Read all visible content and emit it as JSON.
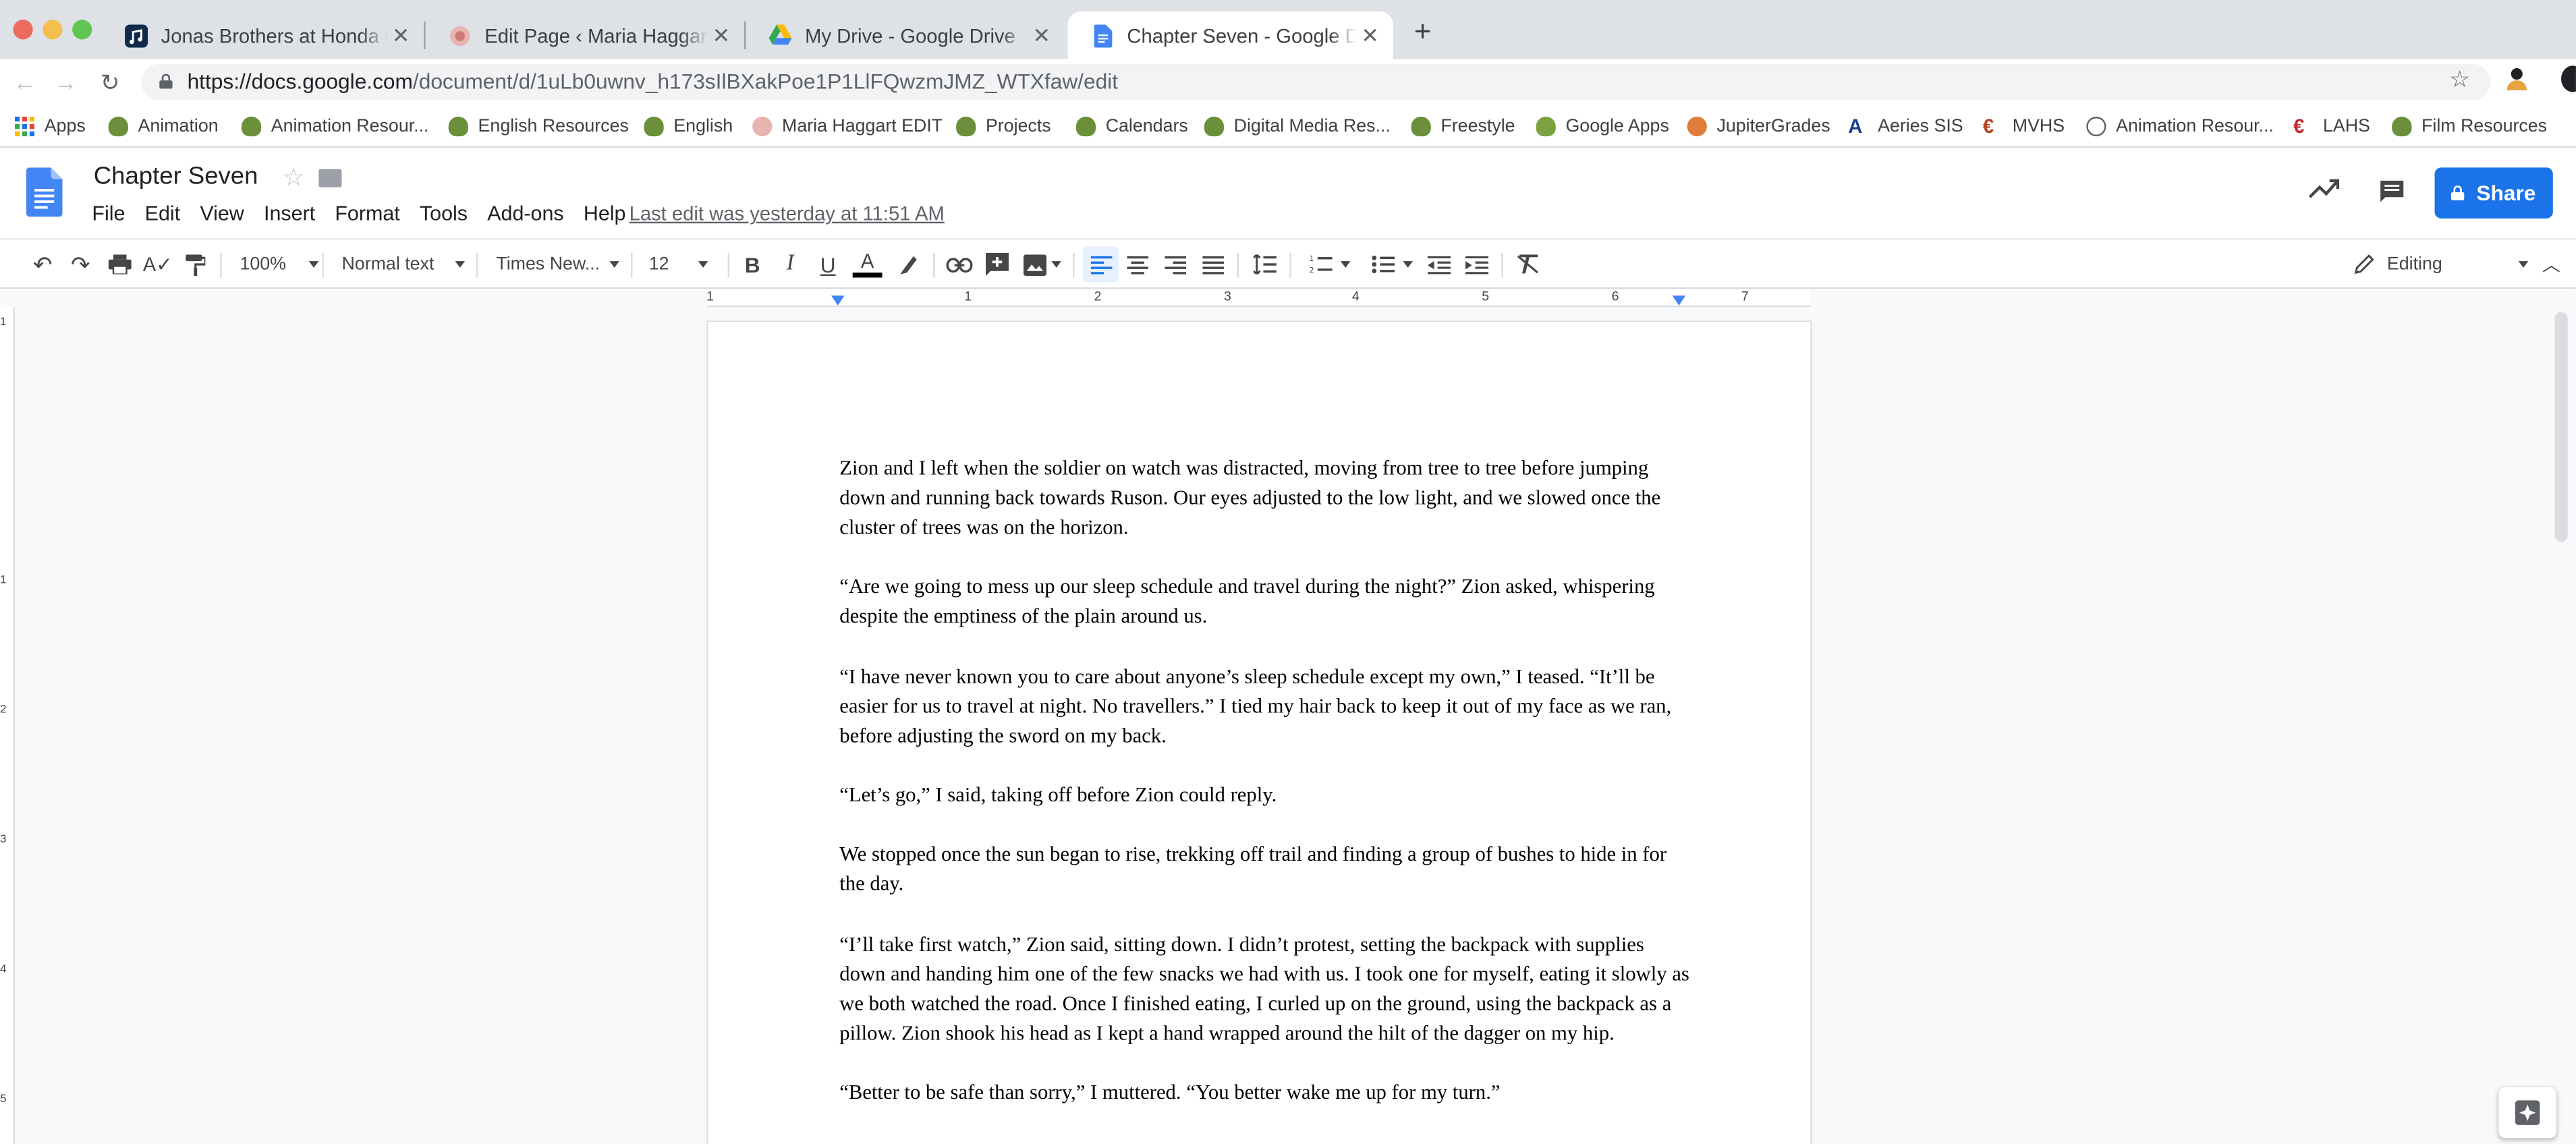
{
  "browser": {
    "tabs": [
      {
        "title": "Jonas Brothers at Honda Center",
        "icon": "music-note-icon"
      },
      {
        "title": "Edit Page ‹ Maria Haggart — WordPress",
        "icon": "site-icon"
      },
      {
        "title": "My Drive - Google Drive",
        "icon": "google-drive-icon"
      },
      {
        "title": "Chapter Seven - Google Docs",
        "icon": "google-docs-icon"
      }
    ],
    "url_host": "https://docs.google.com",
    "url_path": "/document/d/1uLb0uwnv_h173sIlBXakPoe1P1LlFQwzmJMZ_WTXfaw/edit"
  },
  "bookmarks": [
    "Apps",
    "Animation",
    "Animation Resour...",
    "English Resources",
    "English",
    "Maria Haggart EDIT",
    "Projects",
    "Calendars",
    "Digital Media Res...",
    "Freestyle",
    "Google Apps",
    "JupiterGrades",
    "Aeries SIS",
    "MVHS",
    "Animation Resour...",
    "LAHS",
    "Film Resources"
  ],
  "docs": {
    "title": "Chapter Seven",
    "menu": [
      "File",
      "Edit",
      "View",
      "Insert",
      "Format",
      "Tools",
      "Add-ons",
      "Help"
    ],
    "last_edit": "Last edit was yesterday at 11:51 AM",
    "share_label": "Share"
  },
  "toolbar": {
    "zoom": "100%",
    "style": "Normal text",
    "font": "Times New...",
    "font_size": "12",
    "mode": "Editing",
    "text_color": "#000000"
  },
  "ruler": {
    "h_labels": [
      "1",
      "1",
      "2",
      "3",
      "4",
      "5",
      "6",
      "7"
    ],
    "v_labels": [
      "1",
      "1",
      "2",
      "3",
      "4",
      "5"
    ]
  },
  "document": {
    "paragraphs": [
      "Zion and I left when the soldier on watch was distracted, moving from tree to tree before jumping down and running back towards Ruson. Our eyes adjusted to the low light, and we slowed once the cluster of trees was on the horizon.",
      "“Are we going to mess up our sleep schedule and travel during the night?” Zion asked, whispering despite the emptiness of the plain around us.",
      "“I have never known you to care about anyone’s sleep schedule except my own,” I teased. “It’ll be easier for us to travel at night. No travellers.” I tied my hair back to keep it out of my face as we ran, before adjusting the sword on my back.",
      "“Let’s go,” I said, taking off before Zion could reply.",
      "We stopped once the sun began to rise, trekking off trail and finding a group of bushes to hide in for the day.",
      "“I’ll take first watch,” Zion said, sitting down. I didn’t protest, setting the backpack with supplies down and handing him one of the few snacks we had with us. I took one for myself, eating it slowly as we both watched the road. Once I finished eating, I curled up on the ground, using the backpack as a pillow. Zion shook his head as I kept a hand wrapped around the hilt of the dagger on my hip.",
      "“Better to be safe than sorry,” I muttered. “You better wake me up for my turn.”"
    ]
  },
  "colors": {
    "accent": "#1a73e8",
    "tab_strip": "#dee1e6"
  }
}
